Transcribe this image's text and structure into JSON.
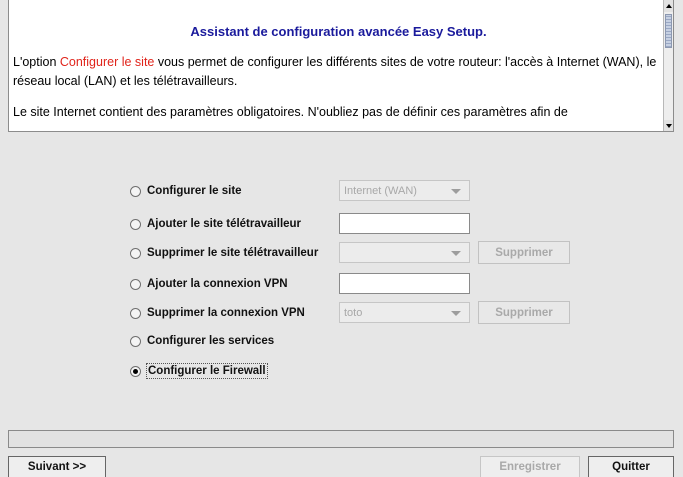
{
  "info": {
    "title": "Assistant de configuration avancée Easy Setup.",
    "para1_prefix": "L'option ",
    "para1_link": "Configurer le site",
    "para1_suffix": " vous permet de configurer les différents sites de votre routeur: l'accès à Internet (WAN), le réseau local (LAN) et les télétravailleurs.",
    "para2": "Le site Internet contient des paramètres obligatoires. N'oubliez pas de définir ces paramètres afin de"
  },
  "options": {
    "configure_site": {
      "label": "Configurer le site",
      "selected": false,
      "combo_value": "Internet (WAN)"
    },
    "add_teleworker": {
      "label": "Ajouter le site télétravailleur",
      "selected": false,
      "input_value": ""
    },
    "remove_teleworker": {
      "label": "Supprimer le site télétravailleur",
      "selected": false,
      "combo_value": "",
      "button_label": "Supprimer"
    },
    "add_vpn": {
      "label": "Ajouter la connexion VPN",
      "selected": false,
      "input_value": ""
    },
    "remove_vpn": {
      "label": "Supprimer la connexion VPN",
      "selected": false,
      "combo_value": "toto",
      "button_label": "Supprimer"
    },
    "configure_services": {
      "label": "Configurer les services",
      "selected": false
    },
    "configure_firewall": {
      "label": "Configurer le Firewall",
      "selected": true
    }
  },
  "footer": {
    "next_label": "Suivant >>",
    "save_label": "Enregistrer",
    "quit_label": "Quitter"
  },
  "colors": {
    "title": "#1a1a9c",
    "link_red": "#e0241b",
    "background": "#e6e6e6"
  }
}
